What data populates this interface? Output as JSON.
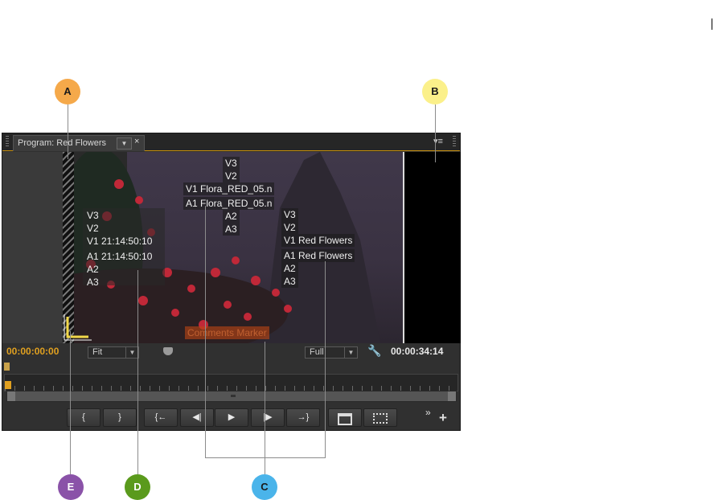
{
  "callouts": [
    "A",
    "B",
    "C",
    "D",
    "E"
  ],
  "colors": {
    "callout_a": "#f5a94a",
    "callout_b": "#fbf08a",
    "callout_c": "#4ab4ea",
    "callout_d": "#5a9a1c",
    "callout_e": "#8a52a8",
    "timecode": "#e0a020",
    "accent_border": "#c8900e"
  },
  "panel": {
    "tab_title": "Program: Red Flowers",
    "close": "×",
    "menu_icon": "▾≡"
  },
  "overlays": {
    "center_top": [
      "V3",
      "V2",
      "V1 Flora_RED_05.n",
      "A1 Flora_RED_05.n",
      "A2",
      "A3"
    ],
    "left": [
      "V3",
      "V2",
      "V1 21:14:50:10",
      "A1 21:14:50:10",
      "A2",
      "A3"
    ],
    "right": [
      "V3",
      "V2",
      "V1 Red Flowers",
      "A1 Red Flowers",
      "A2",
      "A3"
    ],
    "comment_marker": "Comments Marker"
  },
  "controls": {
    "timecode_left": "00:00:00:00",
    "zoom": "Fit",
    "resolution": "Full",
    "timecode_right": "00:00:34:14"
  },
  "transport": {
    "mark_in": "{",
    "mark_out": "}",
    "go_to_in": "{←",
    "step_back": "◀|",
    "play": "▶",
    "step_forward": "|▶",
    "go_to_out": "→}",
    "more": "»",
    "add": "+"
  }
}
